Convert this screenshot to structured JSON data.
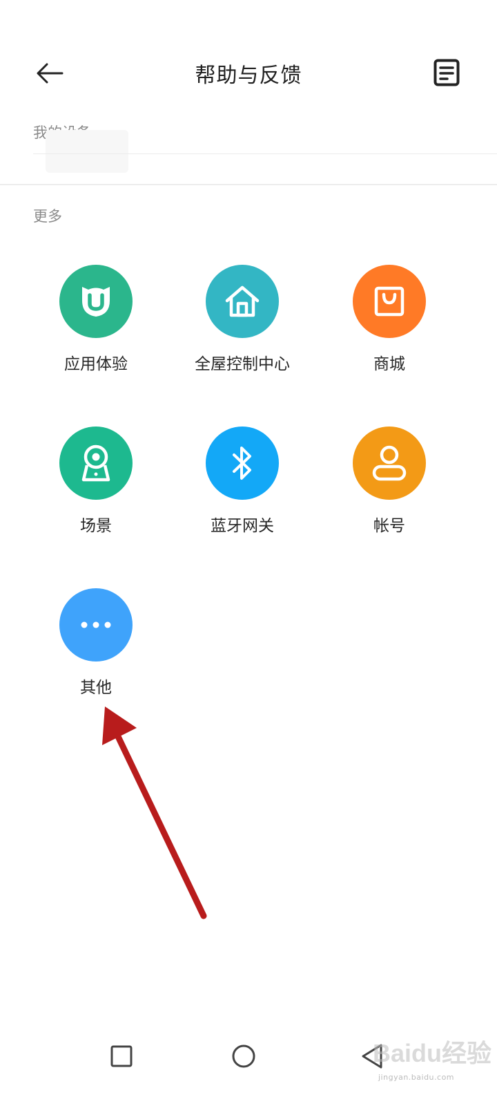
{
  "header": {
    "title": "帮助与反馈"
  },
  "sections": {
    "my_devices": "我的设备",
    "more": "更多"
  },
  "items": [
    {
      "label": "应用体验",
      "icon": "mi-home-logo-icon",
      "color": "#2bb68c"
    },
    {
      "label": "全屋控制中心",
      "icon": "house-icon",
      "color": "#33b6c4"
    },
    {
      "label": "商城",
      "icon": "shopping-bag-icon",
      "color": "#ff7a26"
    },
    {
      "label": "场景",
      "icon": "camera-icon",
      "color": "#1db98f"
    },
    {
      "label": "蓝牙网关",
      "icon": "bluetooth-icon",
      "color": "#13a8f7"
    },
    {
      "label": "帐号",
      "icon": "person-icon",
      "color": "#f39a16"
    },
    {
      "label": "其他",
      "icon": "more-dots-icon",
      "color": "#3fa3fb"
    }
  ],
  "watermark": {
    "brand": "Baidu经验",
    "url": "jingyan.baidu.com"
  }
}
